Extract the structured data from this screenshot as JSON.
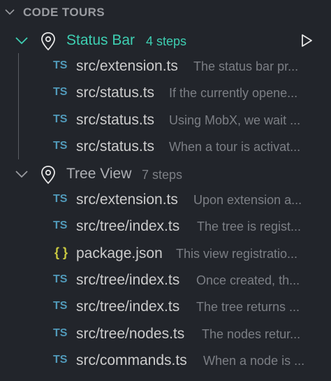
{
  "section": {
    "title": "CODE TOURS",
    "expanded_icon": "chevron-down-icon"
  },
  "colors": {
    "active_tour": "#3ecfb2",
    "inactive_tour": "#aeb0b5",
    "ts_icon": "#519aba",
    "json_icon": "#cbcb41",
    "description": "#7c7f85"
  },
  "tours": [
    {
      "name": "Status Bar",
      "steps_label": "4 steps",
      "active": true,
      "play_icon": "play-icon",
      "steps": [
        {
          "icon": "TS",
          "file": "src/extension.ts",
          "description": "The status bar pr..."
        },
        {
          "icon": "TS",
          "file": "src/status.ts",
          "description": "If the currently opene..."
        },
        {
          "icon": "TS",
          "file": "src/status.ts",
          "description": "Using MobX, we wait ..."
        },
        {
          "icon": "TS",
          "file": "src/status.ts",
          "description": "When a tour is activat..."
        }
      ]
    },
    {
      "name": "Tree View",
      "steps_label": "7 steps",
      "active": false,
      "steps": [
        {
          "icon": "TS",
          "file": "src/extension.ts",
          "description": "Upon extension a..."
        },
        {
          "icon": "TS",
          "file": "src/tree/index.ts",
          "description": "The tree is regist..."
        },
        {
          "icon": "{ }",
          "file": "package.json",
          "description": "This view registratio..."
        },
        {
          "icon": "TS",
          "file": "src/tree/index.ts",
          "description": "Once created, th..."
        },
        {
          "icon": "TS",
          "file": "src/tree/index.ts",
          "description": "The tree returns ..."
        },
        {
          "icon": "TS",
          "file": "src/tree/nodes.ts",
          "description": "The nodes retur..."
        },
        {
          "icon": "TS",
          "file": "src/commands.ts",
          "description": "When a node is ..."
        }
      ]
    }
  ]
}
